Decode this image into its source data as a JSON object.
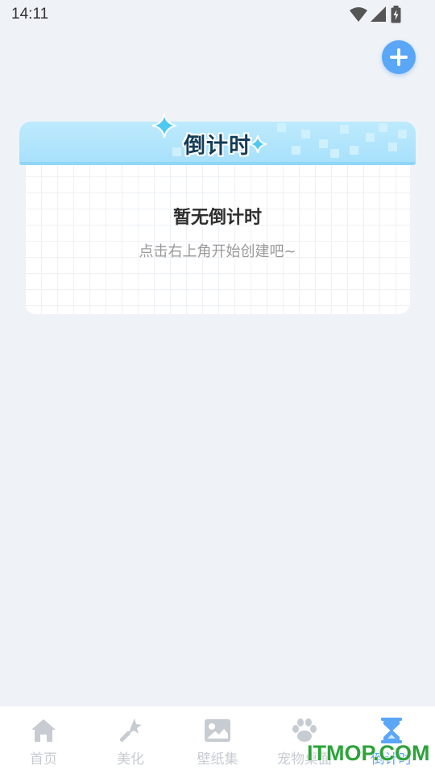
{
  "status_bar": {
    "time": "14:11"
  },
  "header": {
    "add_button_icon": "plus-icon"
  },
  "card": {
    "title": "倒计时",
    "empty_title": "暂无倒计时",
    "empty_subtitle": "点击右上角开始创建吧~"
  },
  "bottom_nav": {
    "items": [
      {
        "label": "首页",
        "icon": "home-icon",
        "active": false
      },
      {
        "label": "美化",
        "icon": "magic-wand-icon",
        "active": false
      },
      {
        "label": "壁纸集",
        "icon": "image-icon",
        "active": false
      },
      {
        "label": "宠物桌面",
        "icon": "paw-icon",
        "active": false
      },
      {
        "label": "倒计时",
        "icon": "hourglass-icon",
        "active": true
      }
    ]
  },
  "watermark": "ITMOP.COM",
  "colors": {
    "accent": "#5aa6f7",
    "header_blue": "#a8e1fb",
    "inactive": "#c7ccd2",
    "background": "#eff3f7"
  }
}
